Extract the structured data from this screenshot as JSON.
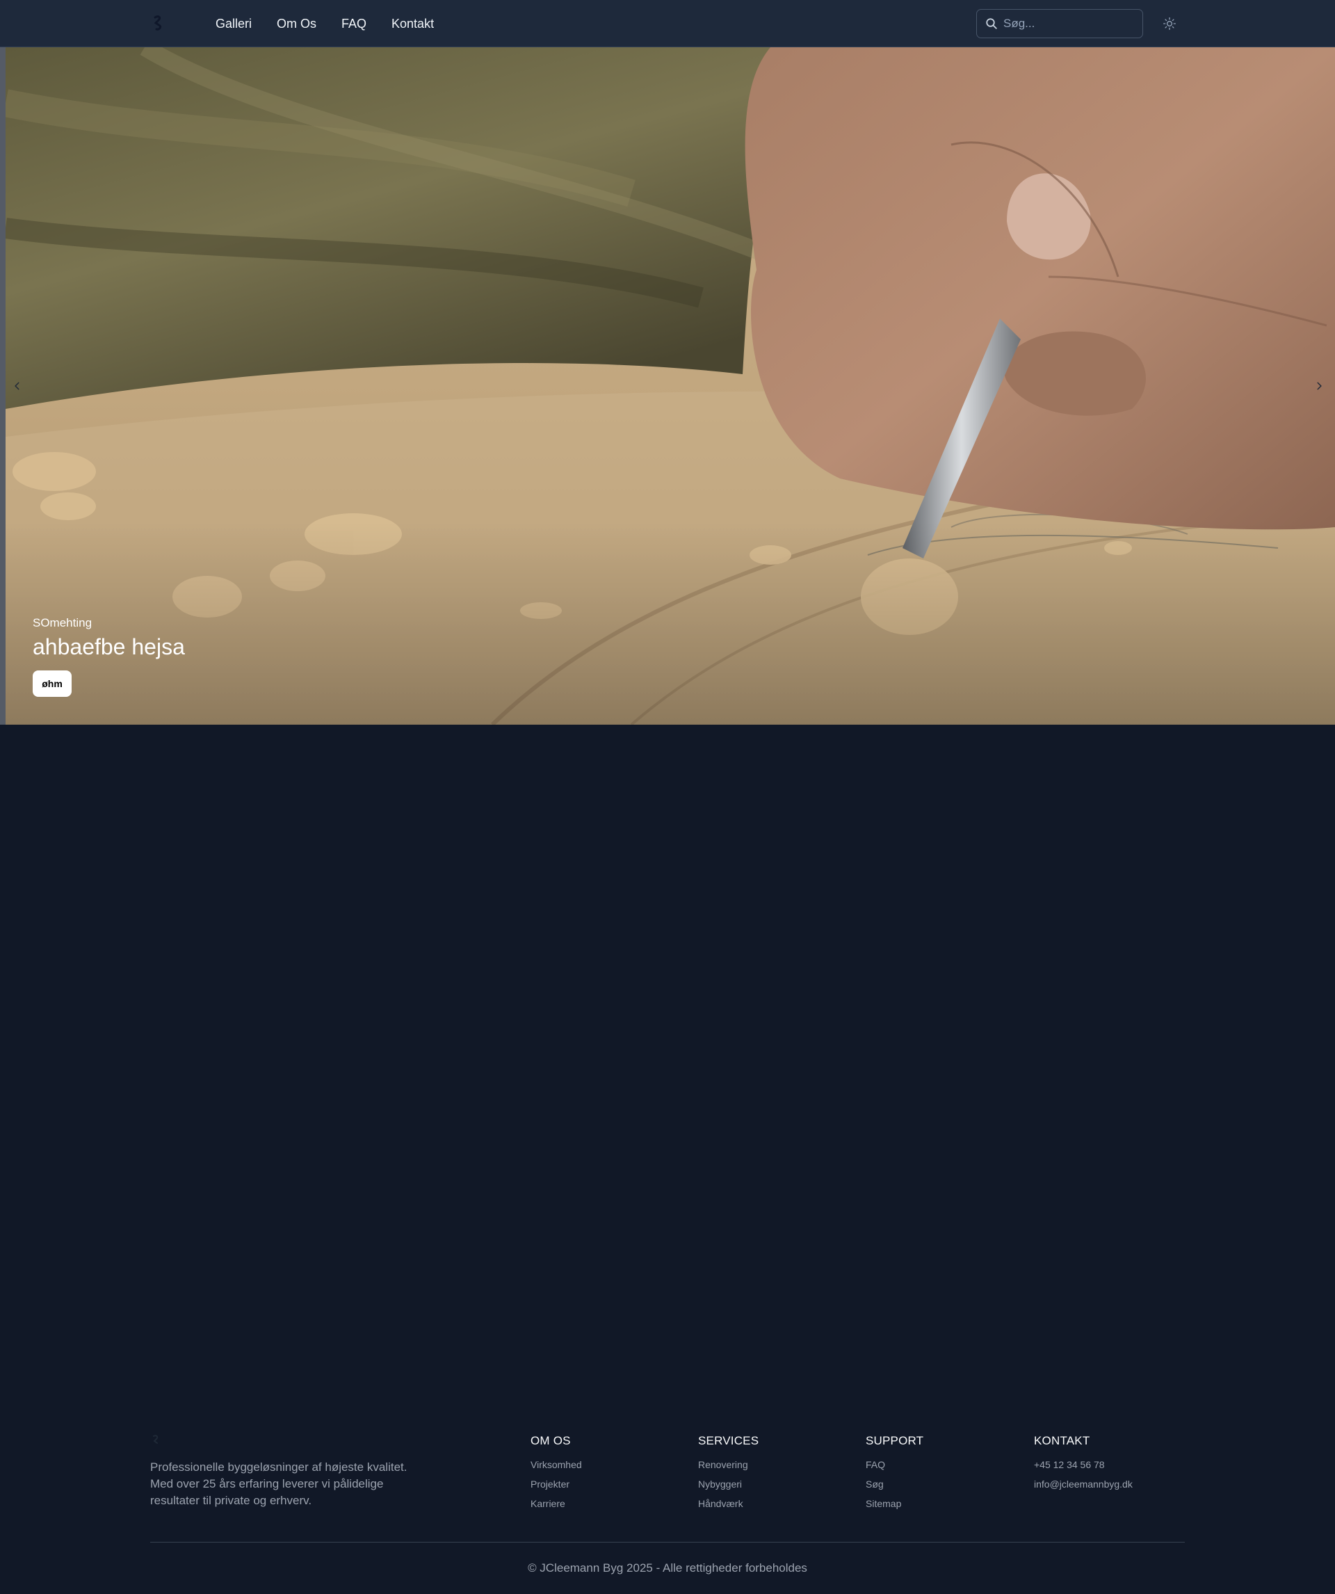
{
  "nav": {
    "links": [
      "Galleri",
      "Om Os",
      "FAQ",
      "Kontakt"
    ],
    "search_placeholder": "Søg..."
  },
  "hero": {
    "subtitle": "SOmehting",
    "title": "ahbaefbe hejsa",
    "button_label": "øhm"
  },
  "footer": {
    "description": "Professionelle byggeløsninger af højeste kvalitet. Med over 25 års erfaring leverer vi pålidelige resultater til private og erhverv.",
    "columns": [
      {
        "heading": "OM OS",
        "items": [
          "Virksomhed",
          "Projekter",
          "Karriere"
        ]
      },
      {
        "heading": "SERVICES",
        "items": [
          "Renovering",
          "Nybyggeri",
          "Håndværk"
        ]
      },
      {
        "heading": "SUPPORT",
        "items": [
          "FAQ",
          "Søg",
          "Sitemap"
        ]
      },
      {
        "heading": "KONTAKT",
        "items": [
          "+45 12 34 56 78",
          "info@jcleemannbyg.dk"
        ]
      }
    ],
    "copyright": "© JCleemann Byg 2025 - Alle rettigheder forbeholdes"
  },
  "colors": {
    "page_bg": "#111827",
    "navbar_bg": "#1e293b",
    "text_muted": "#9ca3af",
    "button_bg": "#ffffff"
  },
  "icons": [
    "logo-icon",
    "search-icon",
    "sun-icon",
    "chevron-left-icon",
    "chevron-right-icon"
  ]
}
